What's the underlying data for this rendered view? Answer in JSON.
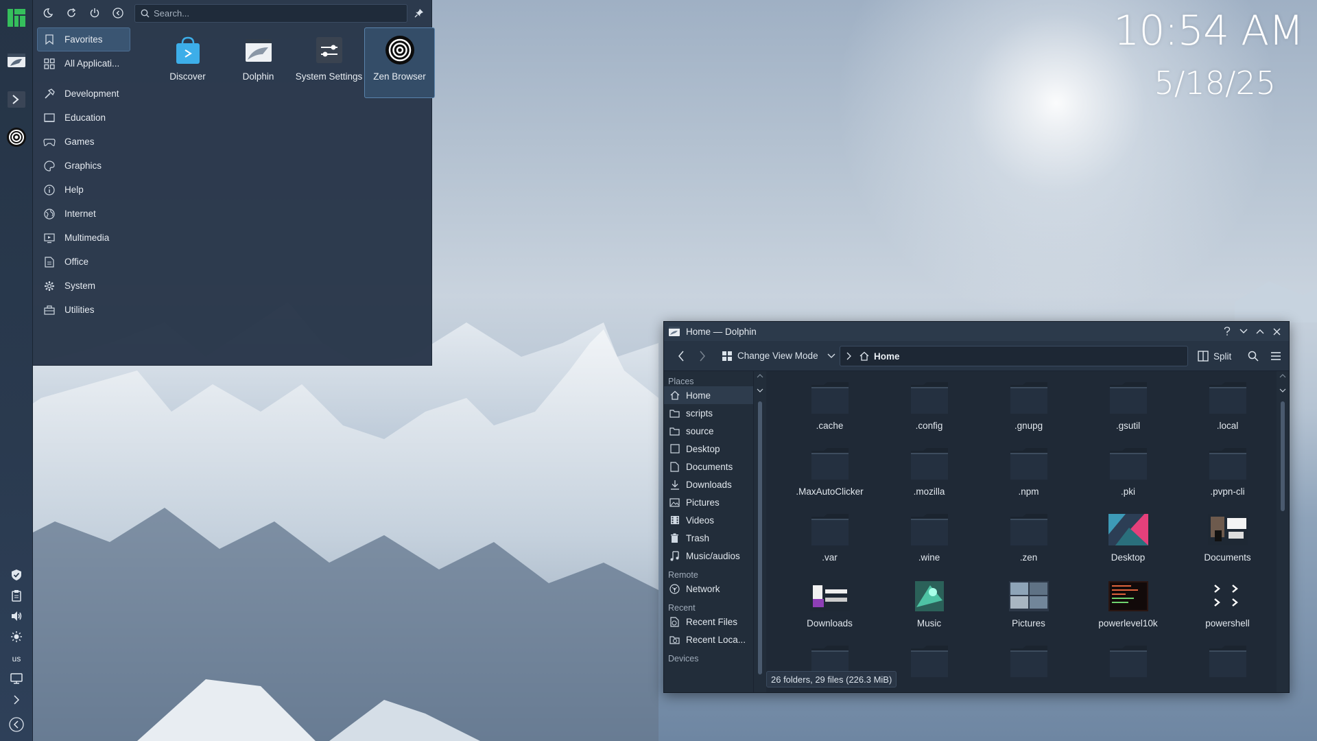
{
  "launcher": {
    "search_placeholder": "Search...",
    "categories": [
      {
        "label": "Favorites",
        "icon": "bookmark-icon"
      },
      {
        "label": "All Applicati...",
        "icon": "grid-icon"
      },
      {
        "label": "Development",
        "icon": "hammer-icon"
      },
      {
        "label": "Education",
        "icon": "education-icon"
      },
      {
        "label": "Games",
        "icon": "gamepad-icon"
      },
      {
        "label": "Graphics",
        "icon": "palette-icon"
      },
      {
        "label": "Help",
        "icon": "info-icon"
      },
      {
        "label": "Internet",
        "icon": "globe-icon"
      },
      {
        "label": "Multimedia",
        "icon": "multimedia-icon"
      },
      {
        "label": "Office",
        "icon": "office-icon"
      },
      {
        "label": "System",
        "icon": "gear-icon"
      },
      {
        "label": "Utilities",
        "icon": "toolbox-icon"
      }
    ],
    "apps": [
      {
        "label": "Discover",
        "icon": "discover-icon"
      },
      {
        "label": "Dolphin",
        "icon": "dolphin-icon"
      },
      {
        "label": "System Settings",
        "icon": "settings-icon"
      },
      {
        "label": "Zen Browser",
        "icon": "zen-icon"
      }
    ]
  },
  "clock": {
    "time": "10:54 AM",
    "date": "5/18/25"
  },
  "panel": {
    "keyboard_layout": "us"
  },
  "dolphin": {
    "title": "Home — Dolphin",
    "view_mode_label": "Change View Mode",
    "breadcrumb_location": "Home",
    "split_label": "Split",
    "places_header": "Places",
    "places": [
      {
        "label": "Home",
        "icon": "home-icon"
      },
      {
        "label": "scripts",
        "icon": "folder-icon"
      },
      {
        "label": "source",
        "icon": "folder-icon"
      },
      {
        "label": "Desktop",
        "icon": "desktop-icon"
      },
      {
        "label": "Documents",
        "icon": "documents-icon"
      },
      {
        "label": "Downloads",
        "icon": "download-icon"
      },
      {
        "label": "Pictures",
        "icon": "pictures-icon"
      },
      {
        "label": "Videos",
        "icon": "videos-icon"
      },
      {
        "label": "Trash",
        "icon": "trash-icon"
      },
      {
        "label": "Music/audios",
        "icon": "music-icon"
      }
    ],
    "remote_header": "Remote",
    "remote": [
      {
        "label": "Network",
        "icon": "network-icon"
      }
    ],
    "recent_header": "Recent",
    "recent": [
      {
        "label": "Recent Files",
        "icon": "recent-files-icon"
      },
      {
        "label": "Recent Loca...",
        "icon": "recent-locations-icon"
      }
    ],
    "devices_header": "Devices",
    "files": [
      {
        "name": ".cache",
        "kind": "folder"
      },
      {
        "name": ".config",
        "kind": "folder"
      },
      {
        "name": ".gnupg",
        "kind": "folder"
      },
      {
        "name": ".gsutil",
        "kind": "folder"
      },
      {
        "name": ".local",
        "kind": "folder"
      },
      {
        "name": ".MaxAutoClicker",
        "kind": "folder"
      },
      {
        "name": ".mozilla",
        "kind": "folder"
      },
      {
        "name": ".npm",
        "kind": "folder"
      },
      {
        "name": ".pki",
        "kind": "folder"
      },
      {
        "name": ".pvpn-cli",
        "kind": "folder"
      },
      {
        "name": ".var",
        "kind": "folder"
      },
      {
        "name": ".wine",
        "kind": "folder"
      },
      {
        "name": ".zen",
        "kind": "folder"
      },
      {
        "name": "Desktop",
        "kind": "desktop-thumb"
      },
      {
        "name": "Documents",
        "kind": "documents-thumb"
      },
      {
        "name": "Downloads",
        "kind": "downloads-thumb"
      },
      {
        "name": "Music",
        "kind": "music-thumb"
      },
      {
        "name": "Pictures",
        "kind": "pictures-thumb"
      },
      {
        "name": "powerlevel10k",
        "kind": "terminal-thumb"
      },
      {
        "name": "powershell",
        "kind": "powershell-thumb"
      },
      {
        "name": "",
        "kind": "folder"
      },
      {
        "name": "",
        "kind": "folder"
      },
      {
        "name": "",
        "kind": "folder"
      },
      {
        "name": "",
        "kind": "folder"
      },
      {
        "name": "",
        "kind": "folder"
      }
    ],
    "status": "26 folders, 29 files (226.3 MiB)"
  },
  "colors": {
    "accent": "#3daee9",
    "launcher_bg": "#283649",
    "window_bg": "#232e3c"
  }
}
